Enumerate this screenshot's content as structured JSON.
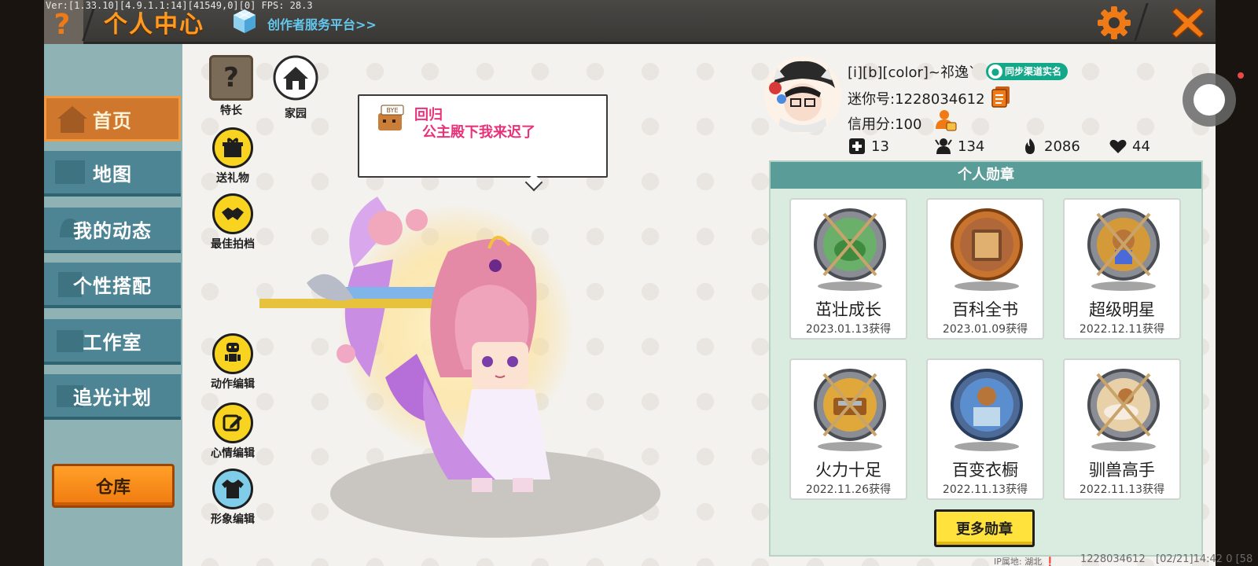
{
  "debug": {
    "text": "Ver:[1.33.10][4.9.1.1:14][41549,0][0] FPS: 28.3"
  },
  "topbar": {
    "help_icon": "question-icon",
    "title": "个人中心",
    "platform_link": "创作者服务平台>>",
    "settings_icon": "gear-icon",
    "close_icon": "close-icon",
    "accent_color": "#f07a16"
  },
  "sidebar": {
    "items": [
      {
        "label": "首页",
        "icon": "house-icon",
        "active": true
      },
      {
        "label": "地图",
        "icon": "map-icon",
        "active": false
      },
      {
        "label": "我的动态",
        "icon": "bell-icon",
        "active": false
      },
      {
        "label": "个性搭配",
        "icon": "outfit-icon",
        "active": false
      },
      {
        "label": "工作室",
        "icon": "studio-icon",
        "active": false
      },
      {
        "label": "追光计划",
        "icon": "spotlight-icon",
        "active": false
      }
    ],
    "warehouse_label": "仓库"
  },
  "actions": {
    "specialty": "特长",
    "homeland": "家园",
    "send_gift": "送礼物",
    "best_partner": "最佳拍档",
    "motion_edit": "动作编辑",
    "mood_edit": "心情编辑",
    "image_edit": "形象编辑"
  },
  "bubble": {
    "icon_text": "BYE",
    "title": "回归",
    "text": "公主殿下我来迟了"
  },
  "profile": {
    "nickname": "[i][b][color]~祁逸`",
    "verify_badge": "同步渠道实名",
    "mini_id": "迷你号:1228034612",
    "credit": "信用分:100",
    "stats": {
      "plus": "13",
      "followers": "134",
      "popularity": "2086",
      "likes": "44"
    }
  },
  "medals": {
    "header": "个人勋章",
    "items": [
      {
        "name": "茁壮成长",
        "date": "2023.01.13获得",
        "color": "#6ab06a",
        "frame": "#8a8e94"
      },
      {
        "name": "百科全书",
        "date": "2023.01.09获得",
        "color": "#b0683a",
        "frame": "#c8742e"
      },
      {
        "name": "超级明星",
        "date": "2022.12.11获得",
        "color": "#d49a3a",
        "frame": "#8a8e94"
      },
      {
        "name": "火力十足",
        "date": "2022.11.26获得",
        "color": "#e0a83a",
        "frame": "#8a8e94"
      },
      {
        "name": "百变衣橱",
        "date": "2022.11.13获得",
        "color": "#5a8ecf",
        "frame": "#4e6a96"
      },
      {
        "name": "驯兽高手",
        "date": "2022.11.13获得",
        "color": "#e8d0a8",
        "frame": "#8a8e94"
      }
    ],
    "more_button": "更多勋章"
  },
  "footer": {
    "ip": "IP属地: 湖北 ❗",
    "id": "1228034612",
    "time": "[02/21]14:42 0  [58"
  }
}
